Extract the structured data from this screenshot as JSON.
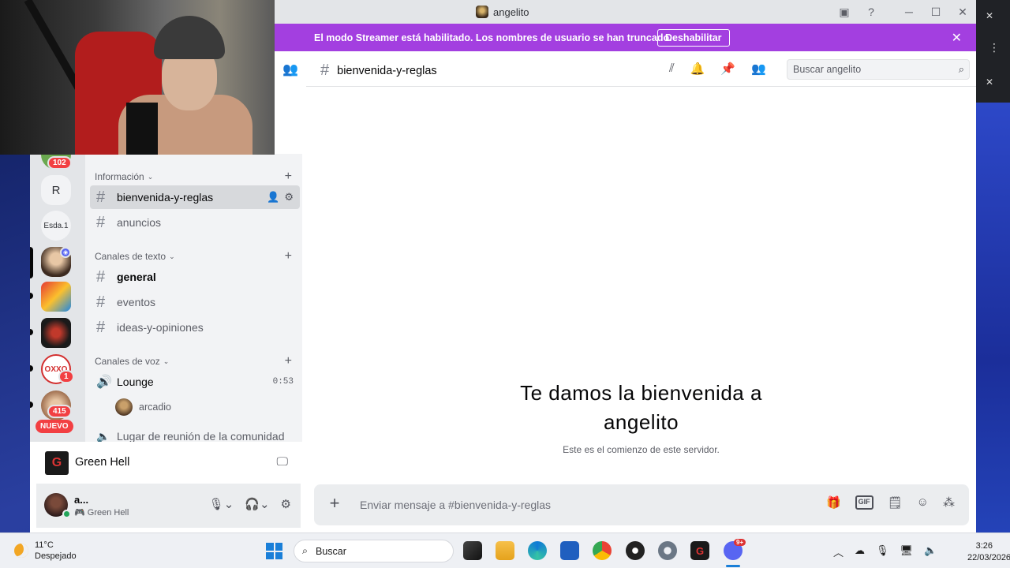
{
  "window": {
    "title": "angelito",
    "controls": {
      "minimize": "─",
      "maximize": "☐",
      "close": "✕"
    }
  },
  "streamer_banner": {
    "text": "El modo Streamer está habilitado. Los nombres de usuario se han truncado.",
    "button": "Deshabilitar",
    "close": "✕"
  },
  "rail": {
    "badge_top": "102",
    "initial_server": "R",
    "text_server": "Esda.1",
    "badge_oxxo": "1",
    "badge_415": "415",
    "new_label": "NUEVO"
  },
  "sidebar": {
    "categories": [
      {
        "label": "Información"
      },
      {
        "label": "Canales de texto"
      },
      {
        "label": "Canales de voz"
      }
    ],
    "channels": [
      {
        "name": "bienvenida-y-reglas"
      },
      {
        "name": "anuncios"
      },
      {
        "name": "general"
      },
      {
        "name": "eventos"
      },
      {
        "name": "ideas-y-opiniones"
      }
    ],
    "voice": {
      "lounge": "Lounge",
      "lounge_time": "0:53",
      "lounge_user": "arcadio",
      "stage": "Lugar de reunión de la comunidad"
    }
  },
  "activity_panel": {
    "game": "Green Hell",
    "icon_letter": "G"
  },
  "user": {
    "name": "a...",
    "activity": "Green Hell"
  },
  "header": {
    "channel": "bienvenida-y-reglas",
    "search_placeholder": "Buscar angelito"
  },
  "welcome": {
    "title_line1": "Te damos la bienvenida a",
    "title_line2": "angelito",
    "subtitle": "Este es el comienzo de este servidor."
  },
  "composer": {
    "placeholder": "Enviar mensaje a #bienvenida-y-reglas",
    "gif": "GIF"
  },
  "taskbar": {
    "temperature": "11°C",
    "weather": "Despejado",
    "search": "Buscar",
    "discord_badge": "9+",
    "time": "3:26",
    "date": "22/03/2026"
  },
  "colors": {
    "streamer_purple": "#a33fe0",
    "voice_green": "#23a55a",
    "badge_red": "#f23f42"
  }
}
